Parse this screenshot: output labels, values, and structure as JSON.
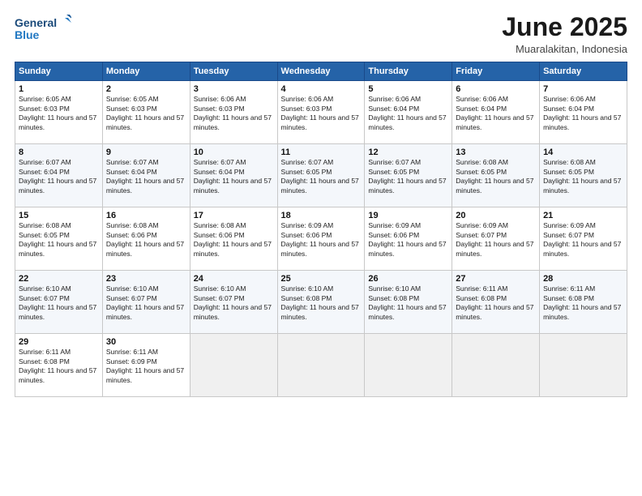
{
  "header": {
    "logo_line1": "General",
    "logo_line2": "Blue",
    "title": "June 2025",
    "subtitle": "Muaralakitan, Indonesia"
  },
  "calendar": {
    "days_of_week": [
      "Sunday",
      "Monday",
      "Tuesday",
      "Wednesday",
      "Thursday",
      "Friday",
      "Saturday"
    ],
    "weeks": [
      [
        null,
        {
          "day": 2,
          "sunrise": "6:05 AM",
          "sunset": "6:03 PM",
          "daylight": "11 hours and 57 minutes."
        },
        {
          "day": 3,
          "sunrise": "6:06 AM",
          "sunset": "6:03 PM",
          "daylight": "11 hours and 57 minutes."
        },
        {
          "day": 4,
          "sunrise": "6:06 AM",
          "sunset": "6:03 PM",
          "daylight": "11 hours and 57 minutes."
        },
        {
          "day": 5,
          "sunrise": "6:06 AM",
          "sunset": "6:04 PM",
          "daylight": "11 hours and 57 minutes."
        },
        {
          "day": 6,
          "sunrise": "6:06 AM",
          "sunset": "6:04 PM",
          "daylight": "11 hours and 57 minutes."
        },
        {
          "day": 7,
          "sunrise": "6:06 AM",
          "sunset": "6:04 PM",
          "daylight": "11 hours and 57 minutes."
        }
      ],
      [
        {
          "day": 8,
          "sunrise": "6:07 AM",
          "sunset": "6:04 PM",
          "daylight": "11 hours and 57 minutes."
        },
        {
          "day": 9,
          "sunrise": "6:07 AM",
          "sunset": "6:04 PM",
          "daylight": "11 hours and 57 minutes."
        },
        {
          "day": 10,
          "sunrise": "6:07 AM",
          "sunset": "6:04 PM",
          "daylight": "11 hours and 57 minutes."
        },
        {
          "day": 11,
          "sunrise": "6:07 AM",
          "sunset": "6:05 PM",
          "daylight": "11 hours and 57 minutes."
        },
        {
          "day": 12,
          "sunrise": "6:07 AM",
          "sunset": "6:05 PM",
          "daylight": "11 hours and 57 minutes."
        },
        {
          "day": 13,
          "sunrise": "6:08 AM",
          "sunset": "6:05 PM",
          "daylight": "11 hours and 57 minutes."
        },
        {
          "day": 14,
          "sunrise": "6:08 AM",
          "sunset": "6:05 PM",
          "daylight": "11 hours and 57 minutes."
        }
      ],
      [
        {
          "day": 15,
          "sunrise": "6:08 AM",
          "sunset": "6:05 PM",
          "daylight": "11 hours and 57 minutes."
        },
        {
          "day": 16,
          "sunrise": "6:08 AM",
          "sunset": "6:06 PM",
          "daylight": "11 hours and 57 minutes."
        },
        {
          "day": 17,
          "sunrise": "6:08 AM",
          "sunset": "6:06 PM",
          "daylight": "11 hours and 57 minutes."
        },
        {
          "day": 18,
          "sunrise": "6:09 AM",
          "sunset": "6:06 PM",
          "daylight": "11 hours and 57 minutes."
        },
        {
          "day": 19,
          "sunrise": "6:09 AM",
          "sunset": "6:06 PM",
          "daylight": "11 hours and 57 minutes."
        },
        {
          "day": 20,
          "sunrise": "6:09 AM",
          "sunset": "6:07 PM",
          "daylight": "11 hours and 57 minutes."
        },
        {
          "day": 21,
          "sunrise": "6:09 AM",
          "sunset": "6:07 PM",
          "daylight": "11 hours and 57 minutes."
        }
      ],
      [
        {
          "day": 22,
          "sunrise": "6:10 AM",
          "sunset": "6:07 PM",
          "daylight": "11 hours and 57 minutes."
        },
        {
          "day": 23,
          "sunrise": "6:10 AM",
          "sunset": "6:07 PM",
          "daylight": "11 hours and 57 minutes."
        },
        {
          "day": 24,
          "sunrise": "6:10 AM",
          "sunset": "6:07 PM",
          "daylight": "11 hours and 57 minutes."
        },
        {
          "day": 25,
          "sunrise": "6:10 AM",
          "sunset": "6:08 PM",
          "daylight": "11 hours and 57 minutes."
        },
        {
          "day": 26,
          "sunrise": "6:10 AM",
          "sunset": "6:08 PM",
          "daylight": "11 hours and 57 minutes."
        },
        {
          "day": 27,
          "sunrise": "6:11 AM",
          "sunset": "6:08 PM",
          "daylight": "11 hours and 57 minutes."
        },
        {
          "day": 28,
          "sunrise": "6:11 AM",
          "sunset": "6:08 PM",
          "daylight": "11 hours and 57 minutes."
        }
      ],
      [
        {
          "day": 29,
          "sunrise": "6:11 AM",
          "sunset": "6:08 PM",
          "daylight": "11 hours and 57 minutes."
        },
        {
          "day": 30,
          "sunrise": "6:11 AM",
          "sunset": "6:09 PM",
          "daylight": "11 hours and 57 minutes."
        },
        null,
        null,
        null,
        null,
        null
      ]
    ],
    "week1_day1": {
      "day": 1,
      "sunrise": "6:05 AM",
      "sunset": "6:03 PM",
      "daylight": "11 hours and 57 minutes."
    }
  }
}
